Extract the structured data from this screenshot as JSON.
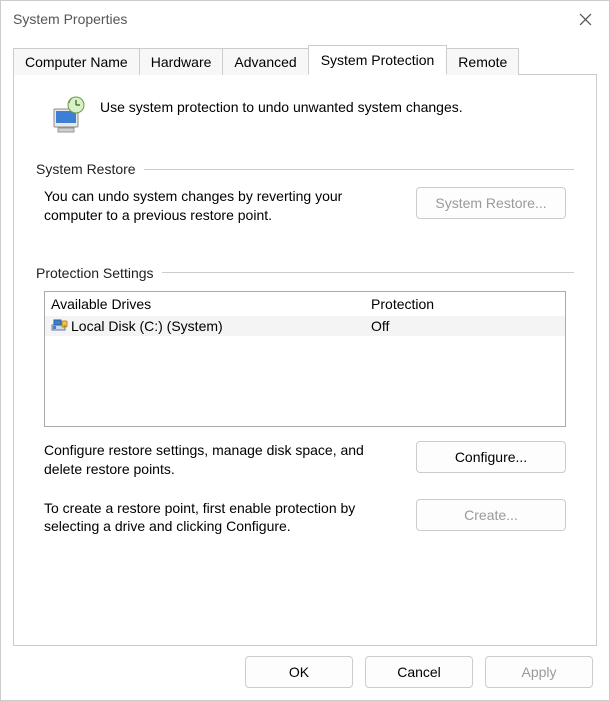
{
  "window": {
    "title": "System Properties"
  },
  "tabs": {
    "computer_name": "Computer Name",
    "hardware": "Hardware",
    "advanced": "Advanced",
    "system_protection": "System Protection",
    "remote": "Remote"
  },
  "intro": "Use system protection to undo unwanted system changes.",
  "groups": {
    "system_restore": {
      "title": "System Restore",
      "desc": "You can undo system changes by reverting your computer to a previous restore point.",
      "button": "System Restore..."
    },
    "protection_settings": {
      "title": "Protection Settings",
      "col_drives": "Available Drives",
      "col_protection": "Protection",
      "rows": [
        {
          "name": "Local Disk (C:) (System)",
          "protection": "Off"
        }
      ],
      "configure_desc": "Configure restore settings, manage disk space, and delete restore points.",
      "configure_button": "Configure...",
      "create_desc": "To create a restore point, first enable protection by selecting a drive and clicking Configure.",
      "create_button": "Create..."
    }
  },
  "buttons": {
    "ok": "OK",
    "cancel": "Cancel",
    "apply": "Apply"
  }
}
